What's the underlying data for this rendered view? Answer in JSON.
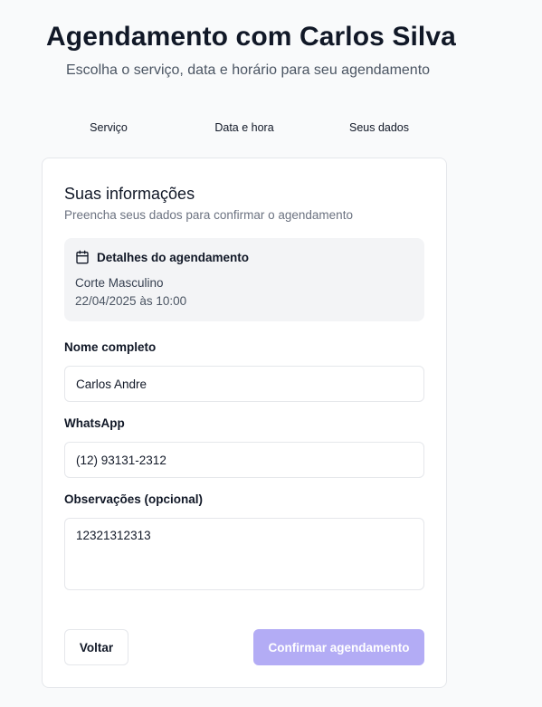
{
  "header": {
    "title": "Agendamento com Carlos Silva",
    "subtitle": "Escolha o serviço, data e horário para seu agendamento"
  },
  "steps": [
    "Serviço",
    "Data e hora",
    "Seus dados"
  ],
  "card": {
    "title": "Suas informações",
    "description": "Preencha seus dados para confirmar o agendamento",
    "details": {
      "icon": "calendar-icon",
      "title": "Detalhes do agendamento",
      "service": "Corte Masculino",
      "datetime": "22/04/2025 às 10:00"
    },
    "form": {
      "name_label": "Nome completo",
      "name_value": "Carlos Andre",
      "whatsapp_label": "WhatsApp",
      "whatsapp_value": "(12) 93131-2312",
      "notes_label": "Observações (opcional)",
      "notes_value": "12321312313"
    },
    "buttons": {
      "back": "Voltar",
      "confirm": "Confirmar agendamento"
    }
  },
  "colors": {
    "background": "#f9fafb",
    "card": "#ffffff",
    "details_bg": "#f3f4f6",
    "confirm_disabled": "#b3acf5"
  }
}
